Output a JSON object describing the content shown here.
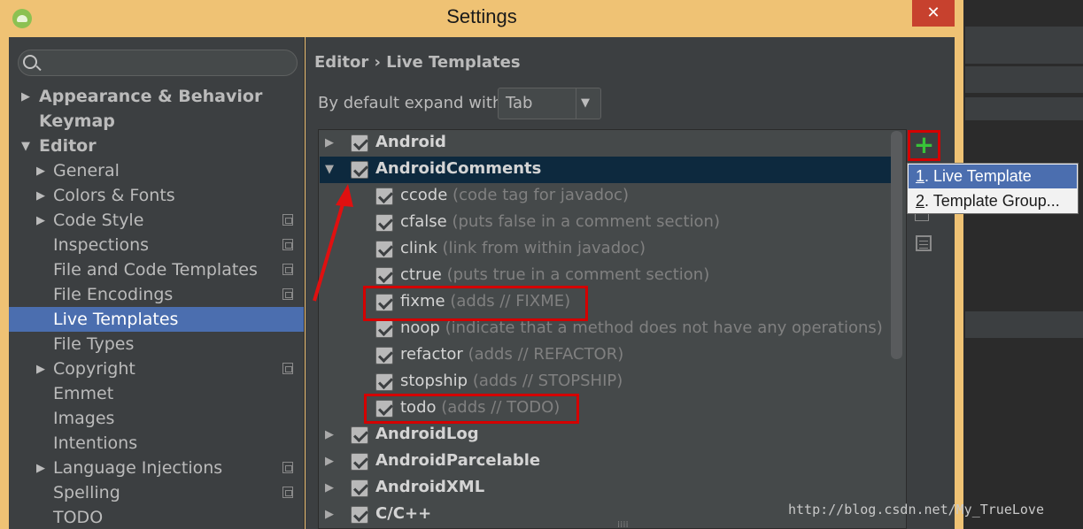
{
  "window": {
    "title": "Settings",
    "close_glyph": "✕"
  },
  "search": {
    "placeholder": ""
  },
  "sidebar": {
    "items": [
      {
        "label": "Appearance & Behavior",
        "arrow": "▶"
      },
      {
        "label": "Keymap",
        "arrow": ""
      },
      {
        "label": "Editor",
        "arrow": "▼"
      },
      {
        "label": "General",
        "arrow": "▶"
      },
      {
        "label": "Colors & Fonts",
        "arrow": "▶"
      },
      {
        "label": "Code Style",
        "arrow": "▶"
      },
      {
        "label": "Inspections",
        "arrow": ""
      },
      {
        "label": "File and Code Templates",
        "arrow": ""
      },
      {
        "label": "File Encodings",
        "arrow": ""
      },
      {
        "label": "Live Templates",
        "arrow": ""
      },
      {
        "label": "File Types",
        "arrow": ""
      },
      {
        "label": "Copyright",
        "arrow": "▶"
      },
      {
        "label": "Emmet",
        "arrow": ""
      },
      {
        "label": "Images",
        "arrow": ""
      },
      {
        "label": "Intentions",
        "arrow": ""
      },
      {
        "label": "Language Injections",
        "arrow": "▶"
      },
      {
        "label": "Spelling",
        "arrow": ""
      },
      {
        "label": "TODO",
        "arrow": ""
      }
    ],
    "selected": "Live Templates"
  },
  "breadcrumb": "Editor › Live Templates",
  "expand": {
    "label": "By default expand with",
    "value": "Tab"
  },
  "groups": [
    {
      "name": "Android",
      "expanded": false
    },
    {
      "name": "AndroidComments",
      "expanded": true
    },
    {
      "name": "AndroidLog",
      "expanded": false
    },
    {
      "name": "AndroidParcelable",
      "expanded": false
    },
    {
      "name": "AndroidXML",
      "expanded": false
    },
    {
      "name": "C/C++",
      "expanded": false
    }
  ],
  "templates": [
    {
      "abbr": "ccode",
      "desc": "(code tag for javadoc)"
    },
    {
      "abbr": "cfalse",
      "desc": "(puts false in a comment section)"
    },
    {
      "abbr": "clink",
      "desc": "(link from within javadoc)"
    },
    {
      "abbr": "ctrue",
      "desc": "(puts true in a comment section)"
    },
    {
      "abbr": "fixme",
      "desc": "(adds // FIXME)"
    },
    {
      "abbr": "noop",
      "desc": "(indicate that a method does not have any operations)"
    },
    {
      "abbr": "refactor",
      "desc": "(adds // REFACTOR)"
    },
    {
      "abbr": "stopship",
      "desc": "(adds // STOPSHIP)"
    },
    {
      "abbr": "todo",
      "desc": "(adds // TODO)"
    }
  ],
  "toolbar": {
    "add_glyph": "+"
  },
  "popup": {
    "items": [
      {
        "num": "1",
        "label": ". Live Template"
      },
      {
        "num": "2",
        "label": ". Template Group..."
      }
    ]
  },
  "watermark": "http://blog.csdn.net/My_TrueLove",
  "colors": {
    "accent": "#4b6eaf",
    "highlight": "#d40000",
    "add": "#38c238"
  }
}
